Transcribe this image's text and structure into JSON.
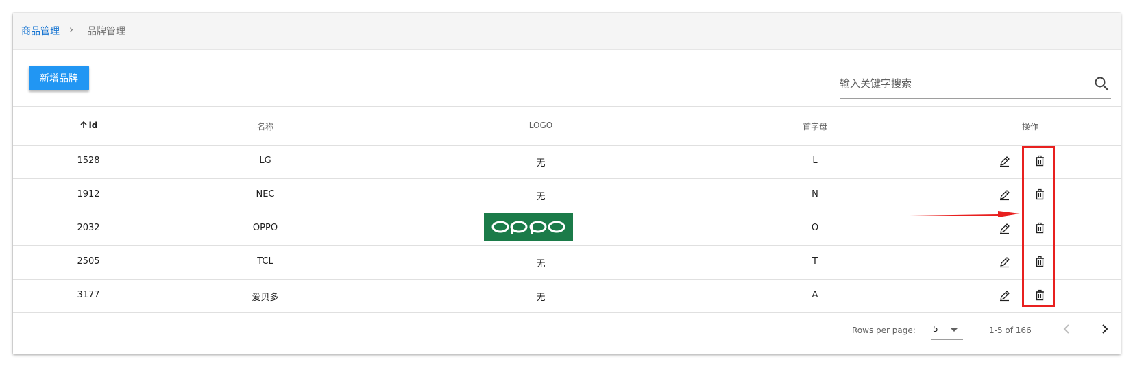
{
  "breadcrumb": {
    "parent": "商品管理",
    "separator": "›",
    "current": "品牌管理"
  },
  "toolbar": {
    "add_label": "新增品牌"
  },
  "search": {
    "placeholder": "输入关键字搜索",
    "value": ""
  },
  "table": {
    "headers": {
      "id": "id",
      "name": "名称",
      "logo": "LOGO",
      "letter": "首字母",
      "actions": "操作"
    },
    "sorted_column": "id",
    "sort_direction": "ascending",
    "rows": [
      {
        "id": "1528",
        "name": "LG",
        "logo": "无",
        "letter": "L"
      },
      {
        "id": "1912",
        "name": "NEC",
        "logo": "无",
        "letter": "N"
      },
      {
        "id": "2032",
        "name": "OPPO",
        "logo_image": "oppo",
        "letter": "O"
      },
      {
        "id": "2505",
        "name": "TCL",
        "logo": "无",
        "letter": "T"
      },
      {
        "id": "3177",
        "name": "爱贝多",
        "logo": "无",
        "letter": "A"
      }
    ]
  },
  "pagination": {
    "rows_per_page_label": "Rows per page:",
    "rows_per_page": "5",
    "range": "1-5 of 166"
  },
  "icons": {
    "edit": "pencil-icon",
    "delete": "trash-icon",
    "search": "search-icon",
    "sort": "arrow-up-icon"
  },
  "colors": {
    "primary": "#2196f3",
    "link": "#1976d2",
    "annotation": "#e8201f",
    "oppo_logo_bg": "#1b7b49"
  }
}
